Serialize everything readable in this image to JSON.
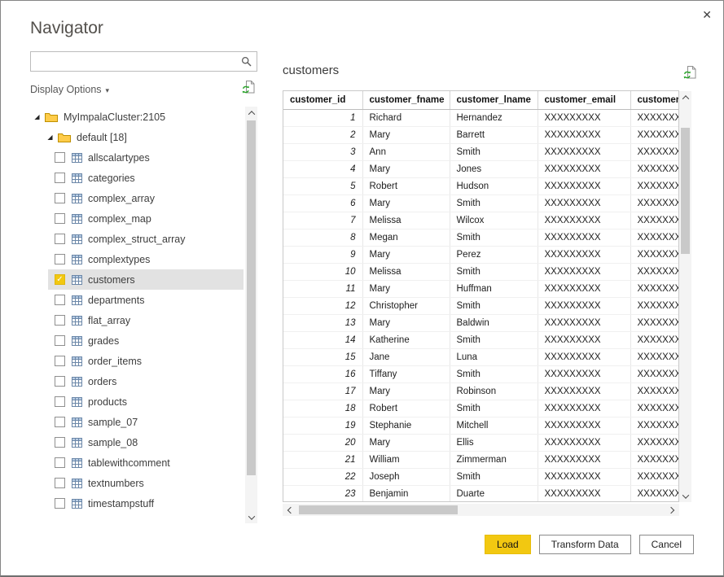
{
  "dialog": {
    "title": "Navigator"
  },
  "icons": {
    "close": "✕",
    "dropdown_caret": "▾",
    "tree_expanded": "◢",
    "checkmark": "✓"
  },
  "colors": {
    "accent": "#f2c811",
    "selection_bg": "#e2e2e2",
    "folder": "#ffcc4a",
    "refresh_green": "#27a327"
  },
  "search": {
    "value": "",
    "placeholder": ""
  },
  "left_panel": {
    "display_options_label": "Display Options",
    "tree": {
      "root_label": "MyImpalaCluster:2105",
      "folder_label": "default [18]",
      "items": [
        {
          "label": "allscalartypes",
          "checked": false,
          "selected": false
        },
        {
          "label": "categories",
          "checked": false,
          "selected": false
        },
        {
          "label": "complex_array",
          "checked": false,
          "selected": false
        },
        {
          "label": "complex_map",
          "checked": false,
          "selected": false
        },
        {
          "label": "complex_struct_array",
          "checked": false,
          "selected": false
        },
        {
          "label": "complextypes",
          "checked": false,
          "selected": false
        },
        {
          "label": "customers",
          "checked": true,
          "selected": true
        },
        {
          "label": "departments",
          "checked": false,
          "selected": false
        },
        {
          "label": "flat_array",
          "checked": false,
          "selected": false
        },
        {
          "label": "grades",
          "checked": false,
          "selected": false
        },
        {
          "label": "order_items",
          "checked": false,
          "selected": false
        },
        {
          "label": "orders",
          "checked": false,
          "selected": false
        },
        {
          "label": "products",
          "checked": false,
          "selected": false
        },
        {
          "label": "sample_07",
          "checked": false,
          "selected": false
        },
        {
          "label": "sample_08",
          "checked": false,
          "selected": false
        },
        {
          "label": "tablewithcomment",
          "checked": false,
          "selected": false
        },
        {
          "label": "textnumbers",
          "checked": false,
          "selected": false
        },
        {
          "label": "timestampstuff",
          "checked": false,
          "selected": false
        }
      ]
    }
  },
  "preview": {
    "title": "customers",
    "columns": [
      "customer_id",
      "customer_fname",
      "customer_lname",
      "customer_email",
      "customer_passw"
    ],
    "rows": [
      [
        "1",
        "Richard",
        "Hernandez",
        "XXXXXXXXX",
        "XXXXXXXXX"
      ],
      [
        "2",
        "Mary",
        "Barrett",
        "XXXXXXXXX",
        "XXXXXXXXX"
      ],
      [
        "3",
        "Ann",
        "Smith",
        "XXXXXXXXX",
        "XXXXXXXXX"
      ],
      [
        "4",
        "Mary",
        "Jones",
        "XXXXXXXXX",
        "XXXXXXXXX"
      ],
      [
        "5",
        "Robert",
        "Hudson",
        "XXXXXXXXX",
        "XXXXXXXXX"
      ],
      [
        "6",
        "Mary",
        "Smith",
        "XXXXXXXXX",
        "XXXXXXXXX"
      ],
      [
        "7",
        "Melissa",
        "Wilcox",
        "XXXXXXXXX",
        "XXXXXXXXX"
      ],
      [
        "8",
        "Megan",
        "Smith",
        "XXXXXXXXX",
        "XXXXXXXXX"
      ],
      [
        "9",
        "Mary",
        "Perez",
        "XXXXXXXXX",
        "XXXXXXXXX"
      ],
      [
        "10",
        "Melissa",
        "Smith",
        "XXXXXXXXX",
        "XXXXXXXXX"
      ],
      [
        "11",
        "Mary",
        "Huffman",
        "XXXXXXXXX",
        "XXXXXXXXX"
      ],
      [
        "12",
        "Christopher",
        "Smith",
        "XXXXXXXXX",
        "XXXXXXXXX"
      ],
      [
        "13",
        "Mary",
        "Baldwin",
        "XXXXXXXXX",
        "XXXXXXXXX"
      ],
      [
        "14",
        "Katherine",
        "Smith",
        "XXXXXXXXX",
        "XXXXXXXXX"
      ],
      [
        "15",
        "Jane",
        "Luna",
        "XXXXXXXXX",
        "XXXXXXXXX"
      ],
      [
        "16",
        "Tiffany",
        "Smith",
        "XXXXXXXXX",
        "XXXXXXXXX"
      ],
      [
        "17",
        "Mary",
        "Robinson",
        "XXXXXXXXX",
        "XXXXXXXXX"
      ],
      [
        "18",
        "Robert",
        "Smith",
        "XXXXXXXXX",
        "XXXXXXXXX"
      ],
      [
        "19",
        "Stephanie",
        "Mitchell",
        "XXXXXXXXX",
        "XXXXXXXXX"
      ],
      [
        "20",
        "Mary",
        "Ellis",
        "XXXXXXXXX",
        "XXXXXXXXX"
      ],
      [
        "21",
        "William",
        "Zimmerman",
        "XXXXXXXXX",
        "XXXXXXXXX"
      ],
      [
        "22",
        "Joseph",
        "Smith",
        "XXXXXXXXX",
        "XXXXXXXXX"
      ],
      [
        "23",
        "Benjamin",
        "Duarte",
        "XXXXXXXXX",
        "XXXXXXXXX"
      ]
    ]
  },
  "footer": {
    "load_label": "Load",
    "transform_label": "Transform Data",
    "cancel_label": "Cancel"
  }
}
